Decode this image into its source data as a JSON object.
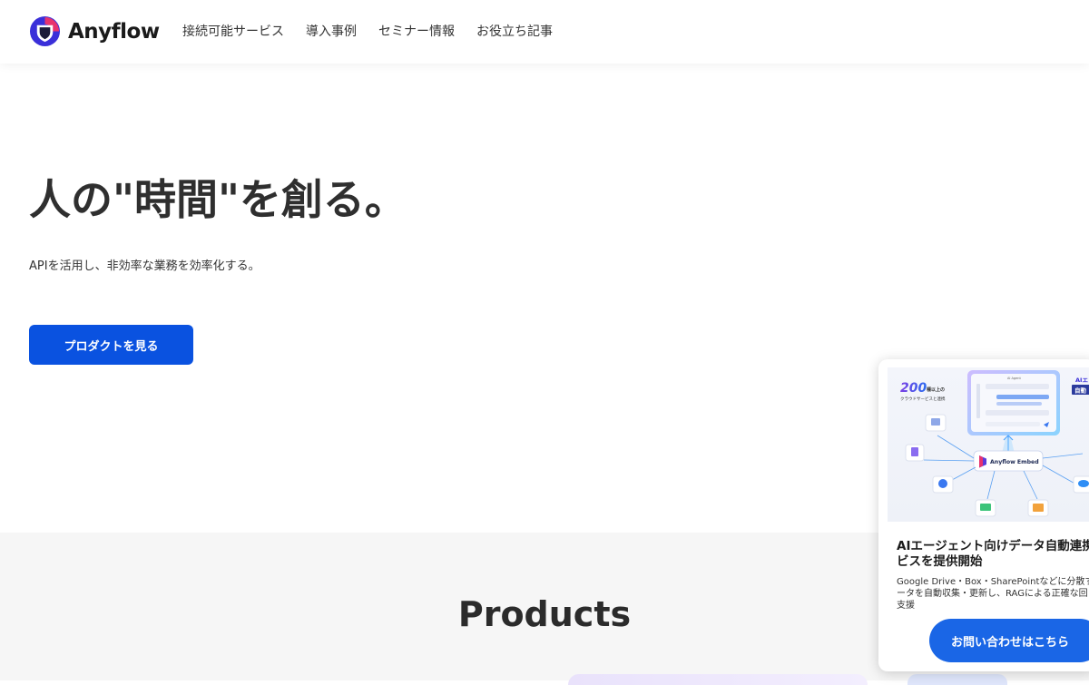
{
  "header": {
    "brand": "Anyflow",
    "brand_colors": {
      "outer": "#3a2fd9",
      "accent": "#e8336e",
      "inner": "#1b1b3a"
    },
    "nav": [
      {
        "label": "接続可能サービス"
      },
      {
        "label": "導入事例"
      },
      {
        "label": "セミナー情報"
      },
      {
        "label": "お役立ち記事"
      }
    ]
  },
  "hero": {
    "title": "人の\"時間\"を創る。",
    "subtitle": "APIを活用し、非効率な業務を効率化する。",
    "cta_label": "プロダクトを見る",
    "cta_color": "#0a52e0"
  },
  "products": {
    "title": "Products"
  },
  "popup": {
    "visual": {
      "badge_number": "200",
      "badge_suffix": "種以上の",
      "badge_caption": "クラウドサービスと連携",
      "panel_title": "AI Agent",
      "hub_label": "Anyflow Embed",
      "right_badge_top": "AIエ",
      "right_badge_bottom": "自動"
    },
    "headline": "AIエージェント向けデータ自動連携サー\nビスを提供開始",
    "body": "Google Drive・Box・SharePointなどに分散す\nータを自動収集・更新し、RAGによる正確な回\n支援",
    "button_label": "お問い合わせはこちら",
    "button_color": "#1a66e6"
  }
}
